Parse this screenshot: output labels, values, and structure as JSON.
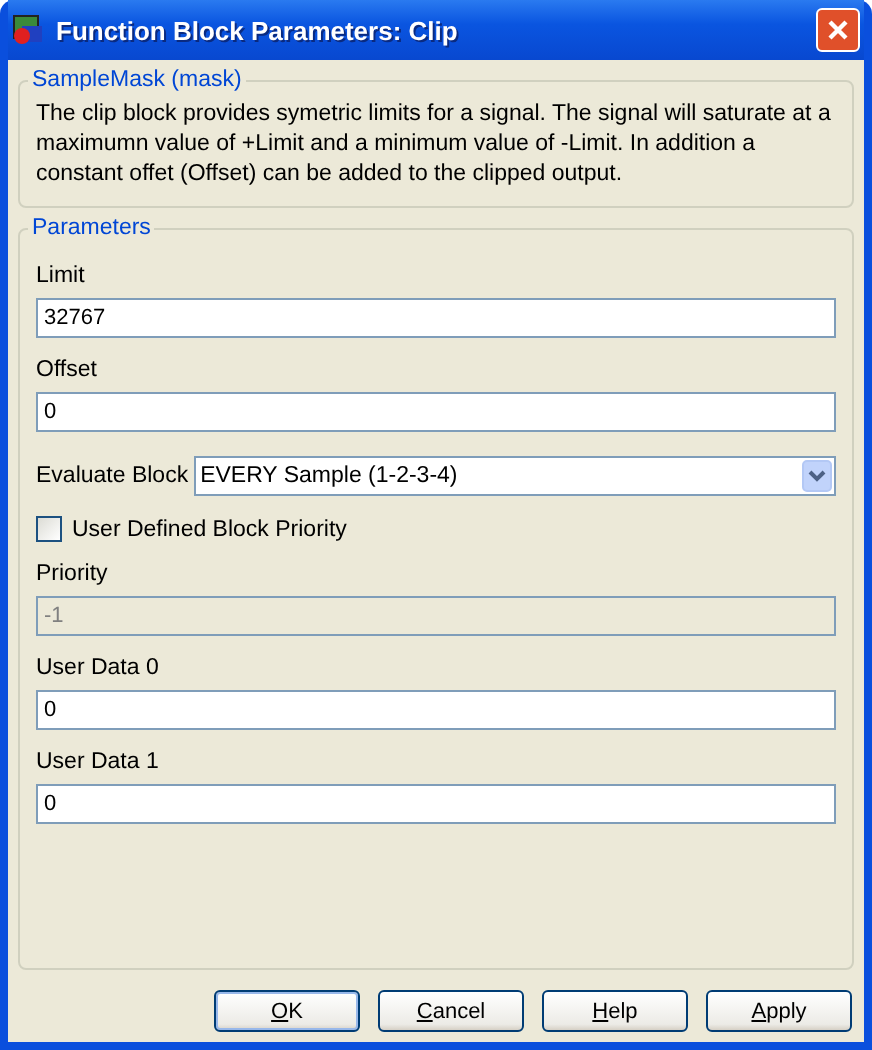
{
  "window": {
    "title": "Function Block Parameters: Clip"
  },
  "description": {
    "title": "SampleMask (mask)",
    "text": "The clip block provides symetric limits for a signal. The signal will saturate at a maximumn value of +Limit and a minimum value of -Limit. In addition a constant offet (Offset) can be added to the clipped output."
  },
  "parameters": {
    "title": "Parameters",
    "items": [
      {
        "kind": "text",
        "label": "Limit",
        "value": "32767",
        "disabled": false
      },
      {
        "kind": "text",
        "label": "Offset",
        "value": "0",
        "disabled": false
      },
      {
        "kind": "dropdown",
        "label": "Evaluate Block",
        "value": "EVERY Sample (1-2-3-4)"
      },
      {
        "kind": "checkbox",
        "label": "User Defined Block Priority",
        "checked": false
      },
      {
        "kind": "text",
        "label": "Priority",
        "value": "-1",
        "disabled": true
      },
      {
        "kind": "text",
        "label": "User Data 0",
        "value": "0",
        "disabled": false
      },
      {
        "kind": "text",
        "label": "User Data 1",
        "value": "0",
        "disabled": false
      }
    ]
  },
  "buttons": [
    {
      "label": "OK",
      "mnemonic": true,
      "default": true
    },
    {
      "label": "Cancel",
      "mnemonic": true,
      "default": false
    },
    {
      "label": "Help",
      "mnemonic": true,
      "default": false
    },
    {
      "label": "Apply",
      "mnemonic": true,
      "default": false
    }
  ]
}
